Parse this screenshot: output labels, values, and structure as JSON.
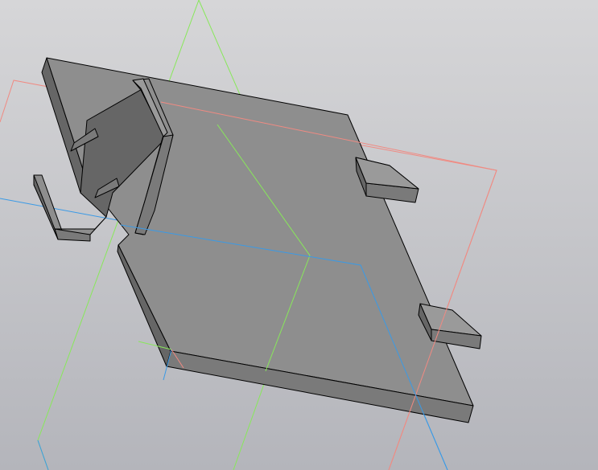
{
  "viewport": {
    "background_top": "#d6d6d8",
    "background_bottom": "#b4b5bb"
  },
  "model": {
    "face_color": "#8e8e8e",
    "side_color": "#7a7a7a",
    "dark_side_color": "#666666",
    "top_color": "#9a9a9a",
    "edge_color": "#000000"
  },
  "planes": {
    "yz_color": "#88e85a",
    "xz_color": "#f08a82",
    "xy_color": "#3a9ae6"
  },
  "origin_axes": {
    "x_color": "#f08a82",
    "y_color": "#88e85a",
    "z_color": "#3a9ae6"
  }
}
